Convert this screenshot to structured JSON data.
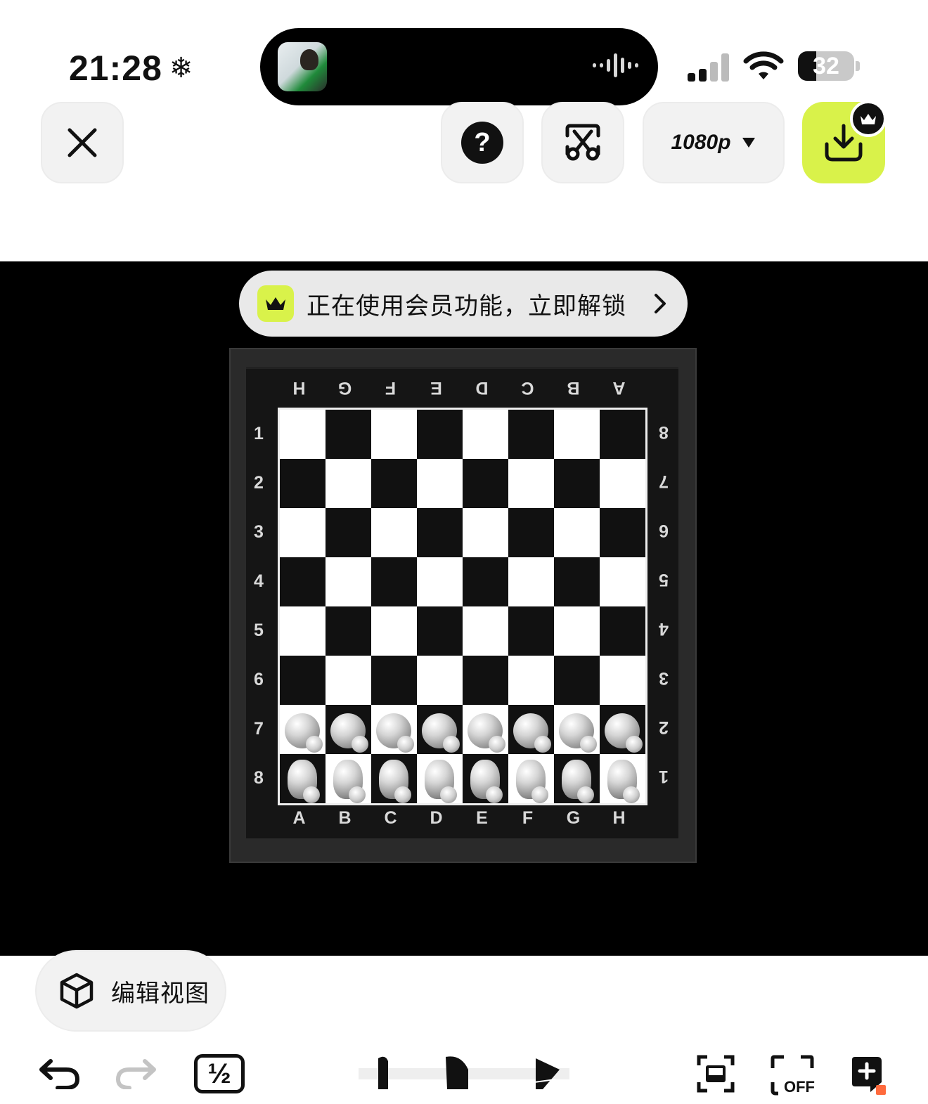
{
  "status_bar": {
    "time": "21:28",
    "snow_glyph": "❄",
    "battery_level": "32",
    "icons": [
      "signal-icon",
      "wifi-icon",
      "battery-icon"
    ]
  },
  "toolbar": {
    "help_glyph": "?",
    "resolution_label": "1080p"
  },
  "banner": {
    "text": "正在使用会员功能，立即解锁"
  },
  "board": {
    "files": [
      "A",
      "B",
      "C",
      "D",
      "E",
      "F",
      "G",
      "H"
    ],
    "files_top_reversed": [
      "H",
      "G",
      "F",
      "E",
      "D",
      "C",
      "B",
      "A"
    ],
    "ranks_left": [
      "1",
      "2",
      "3",
      "4",
      "5",
      "6",
      "7",
      "8"
    ],
    "ranks_right": [
      "8",
      "7",
      "6",
      "5",
      "4",
      "3",
      "2",
      "1"
    ]
  },
  "bottom": {
    "edit_view_label": "编辑视图",
    "half_label": "½",
    "off_label": "OFF"
  },
  "colors": {
    "accent": "#d9f24a",
    "stage": "#000000",
    "button_bg": "#f2f2f2"
  }
}
